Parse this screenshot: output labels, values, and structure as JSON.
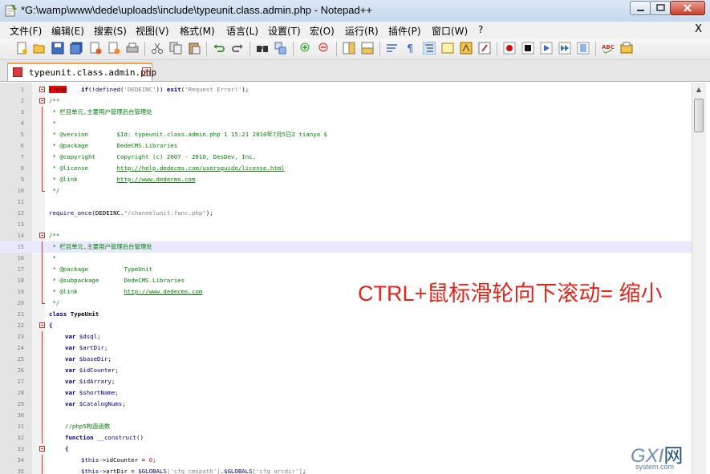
{
  "window": {
    "title": "*G:\\wamp\\www\\dede\\uploads\\include\\typeunit.class.admin.php - Notepad++"
  },
  "menu": {
    "items": [
      "文件(F)",
      "编辑(E)",
      "搜索(S)",
      "视图(V)",
      "格式(M)",
      "语言(L)",
      "设置(T)",
      "宏(O)",
      "运行(R)",
      "插件(P)",
      "窗口(W)",
      "?"
    ],
    "close": "X"
  },
  "tab": {
    "label": "typeunit.class.admin.php",
    "close": "x"
  },
  "editor": {
    "highlighted_line": 15,
    "lines": [
      {
        "n": "1"
      },
      {
        "n": "2"
      },
      {
        "n": "3"
      },
      {
        "n": "4"
      },
      {
        "n": "5"
      },
      {
        "n": "6"
      },
      {
        "n": "7"
      },
      {
        "n": "8"
      },
      {
        "n": "9"
      },
      {
        "n": "10"
      },
      {
        "n": "11"
      },
      {
        "n": "12"
      },
      {
        "n": "13"
      },
      {
        "n": "14"
      },
      {
        "n": "15"
      },
      {
        "n": "16"
      },
      {
        "n": "17"
      },
      {
        "n": "18"
      },
      {
        "n": "19"
      },
      {
        "n": "20"
      },
      {
        "n": "21"
      },
      {
        "n": "22"
      },
      {
        "n": "23"
      },
      {
        "n": "24"
      },
      {
        "n": "25"
      },
      {
        "n": "26"
      },
      {
        "n": "27"
      },
      {
        "n": "28"
      },
      {
        "n": "29"
      },
      {
        "n": "30"
      },
      {
        "n": "31"
      },
      {
        "n": "32"
      },
      {
        "n": "33"
      },
      {
        "n": "34"
      },
      {
        "n": "35"
      }
    ],
    "code": {
      "l1_tag": "<?php",
      "l1_if": "if",
      "l1_a": "(!",
      "l1_defined": "defined",
      "l1_b": "(",
      "l1_str": "'DEDEINC'",
      "l1_c": ")) ",
      "l1_exit": "exit",
      "l1_d": "(",
      "l1_str2": "'Request Error!'",
      "l1_e": ");",
      "l2": "/**",
      "l3": " * 栏目单元,主要用户管理后台管理处",
      "l4": " *",
      "l5": " * @version        $Id: typeunit.class.admin.php 1 15:21 2010年7月5日Z tianya $",
      "l6": " * @package        DedeCMS.Libraries",
      "l7": " * @copyright      Copyright (c) 2007 - 2010, DesDev, Inc.",
      "l8_a": " * @license        ",
      "l8_link": "http://help.dedecms.com/usersguide/license.html",
      "l9_a": " * @link           ",
      "l9_link": "http://www.dedecms.com",
      "l10": " */",
      "l12_fn": "require_once",
      "l12_a": "(",
      "l12_const": "DEDEINC",
      "l12_b": ".",
      "l12_str": "\"/channelunit.func.php\"",
      "l12_c": ");",
      "l14": "/**",
      "l15": " * 栏目单元,主要用户管理后台管理处",
      "l16": " *",
      "l17": " * @package          TypeUnit",
      "l18": " * @subpackage       DedeCMS.Libraries",
      "l19_a": " * @link             ",
      "l19_link": "http://www.dedecms.com",
      "l20": " */",
      "l21_kw": "class",
      "l21_name": " TypeUnit",
      "l22": "{",
      "l23_kw": "var",
      "l23_v": " $dsql",
      "l24_kw": "var",
      "l24_v": " $artDir",
      "l25_kw": "var",
      "l25_v": " $baseDir",
      "l26_kw": "var",
      "l26_v": " $idCounter",
      "l27_kw": "var",
      "l27_v": " $idArrary",
      "l28_kw": "var",
      "l28_v": " $shortName",
      "l29_kw": "var",
      "l29_v": " $CatalogNums",
      "semi": ";",
      "l31": "//php5构造函数",
      "l32_kw": "function",
      "l32_fn": " __construct",
      "l32_p": "()",
      "l33": "{",
      "l34_v": "$this",
      "l34_op": "->",
      "l34_p": "idCounter",
      "l34_eq": " = ",
      "l34_num": "0",
      "l35_v": "$this",
      "l35_op": "->",
      "l35_p": "artDir",
      "l35_eq": " = ",
      "l35_g1": "$GLOBALS",
      "l35_s1": "['cfg_cmspath']",
      "l35_dot": ".",
      "l35_g2": "$GLOBALS",
      "l35_s2": "['cfg_arcdir']",
      "l35_end": ";"
    }
  },
  "overlay": {
    "text": "CTRL+鼠标滑轮向下滚动= 缩小"
  },
  "watermark": {
    "main": "GXI",
    "cn": "网",
    "sub": "system.com"
  },
  "colors": {
    "annotation": "#e0261b",
    "comment": "#008000",
    "keyword": "#000080",
    "fold_marker": "#c0392b"
  },
  "icons": [
    "new-file-icon",
    "open-icon",
    "save-icon",
    "save-all-icon",
    "close-icon",
    "close-all-icon",
    "print-icon",
    "cut-icon",
    "copy-icon",
    "paste-icon",
    "undo-icon",
    "redo-icon",
    "find-icon",
    "replace-icon",
    "zoom-in-icon",
    "zoom-out-icon",
    "sync-v-icon",
    "sync-h-icon",
    "wrap-icon",
    "all-chars-icon",
    "indent-guide-icon",
    "udl-icon",
    "doc-map-icon",
    "function-list-icon",
    "record-macro-icon",
    "stop-macro-icon",
    "play-macro-icon",
    "run-macro-icon",
    "save-macro-icon",
    "spellcheck-icon",
    "plugin-icon"
  ]
}
